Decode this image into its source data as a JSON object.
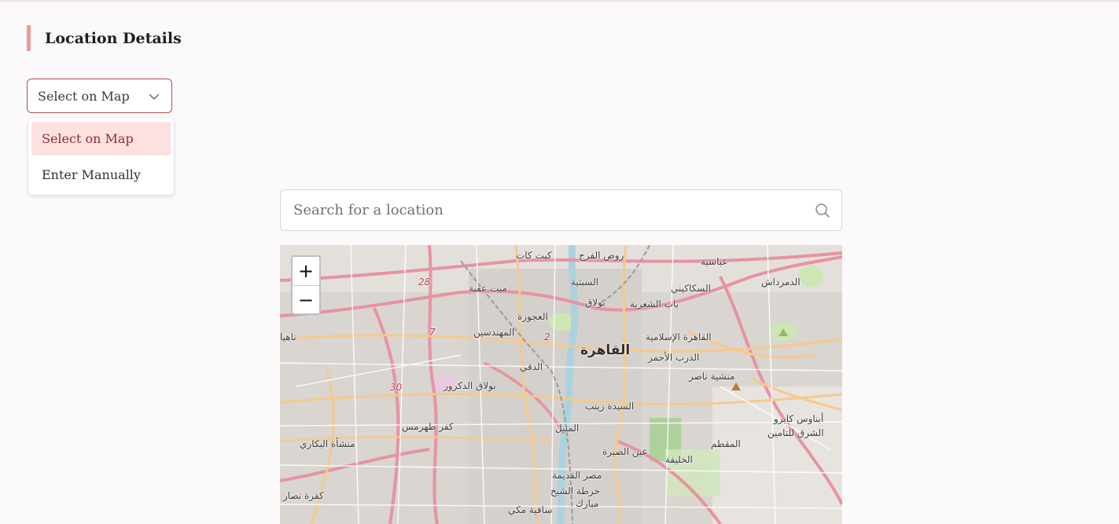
{
  "section": {
    "title": "Location Details"
  },
  "location_mode": {
    "selected": "Select on Map",
    "options": [
      {
        "label": "Select on Map",
        "selected": true
      },
      {
        "label": "Enter Manually",
        "selected": false
      }
    ]
  },
  "search": {
    "placeholder": "Search for a location",
    "value": ""
  },
  "map": {
    "zoom_in": "+",
    "zoom_out": "−",
    "labels": [
      "كيت كات",
      "روض الفرج",
      "عباسية",
      "السبتية",
      "الدمرداش",
      "ميت عقبة",
      "بولاق",
      "السكاكيني",
      "باب الشعرية",
      "العجوزة",
      "المهندسين",
      "القاهرة",
      "القاهرة الإسلامية",
      "الدرب الأحمر",
      "الدقي",
      "منشية ناصر",
      "بولاق الدكرور",
      "السيدة زينب",
      "أبناوس كايرو",
      "الشرق للتامين",
      "كفر طهرمس",
      "المنيل",
      "منشأة البكاري",
      "عين الصيرة",
      "الخليفة",
      "المقطم",
      "مصر القديمة",
      "خرطة الشيخ",
      "مبارك",
      "كفرة نصار",
      "ساقية مكي",
      "ناهيا"
    ],
    "road_numbers": [
      "28",
      "7",
      "2",
      "30"
    ],
    "colors": {
      "major_road": "#e892a2",
      "primary_road": "#f6c98a",
      "park": "#cde7b4",
      "water": "#aad3df"
    }
  }
}
